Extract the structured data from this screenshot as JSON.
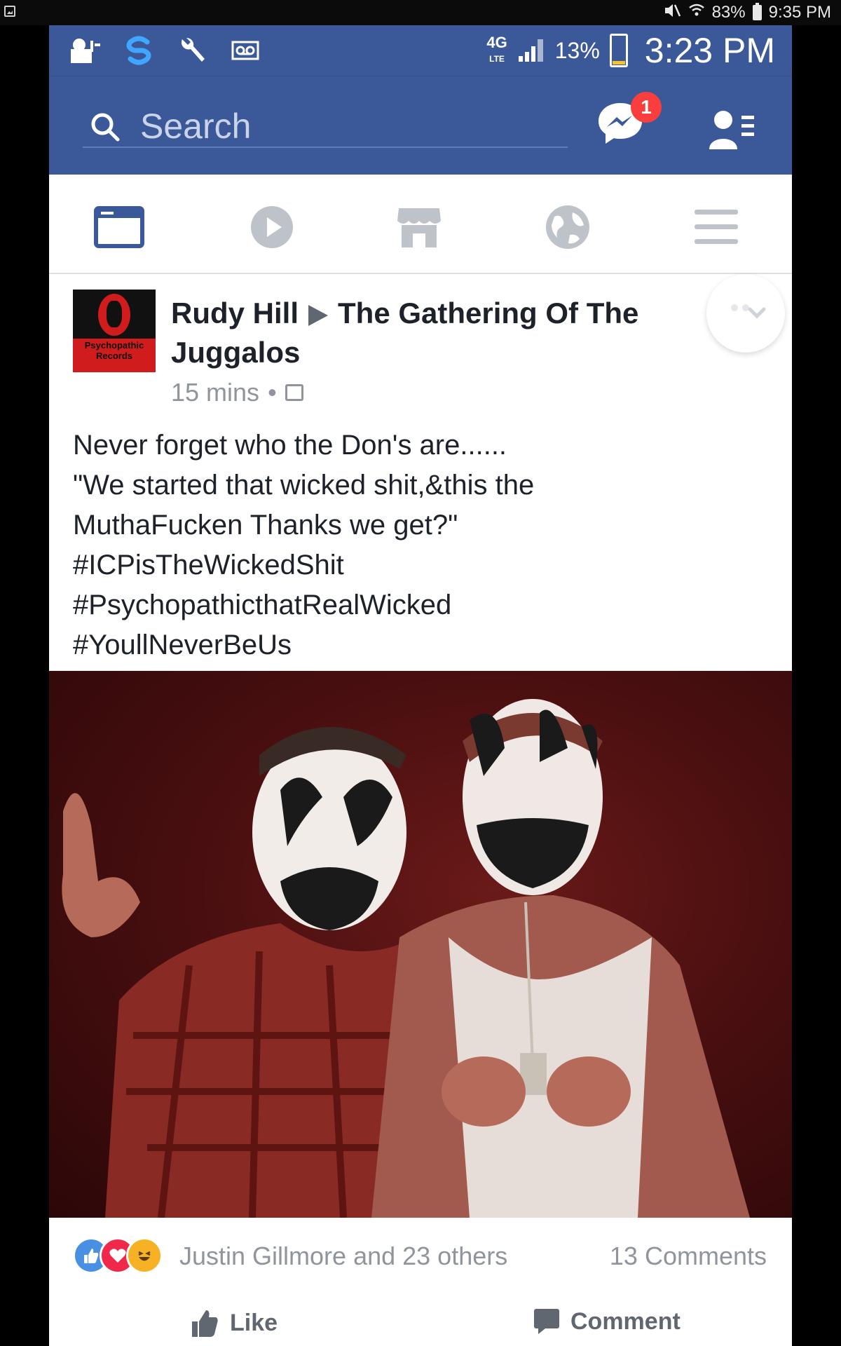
{
  "device_status": {
    "battery": "83%",
    "time": "9:35 PM"
  },
  "phone_status": {
    "network": "4G",
    "network_sub": "LTE",
    "battery": "13%",
    "time": "3:23 PM"
  },
  "header": {
    "search_placeholder": "Search",
    "messenger_badge": "1",
    "brand_color": "#3b5998"
  },
  "tabs": [
    {
      "name": "news-feed",
      "active": true
    },
    {
      "name": "video",
      "active": false
    },
    {
      "name": "marketplace",
      "active": false
    },
    {
      "name": "notifications",
      "active": false
    },
    {
      "name": "menu",
      "active": false
    }
  ],
  "post": {
    "avatar_text_1": "Psychopathic",
    "avatar_text_2": "Records",
    "author": "Rudy Hill",
    "target_line_1": "The Gathering Of The",
    "target_line_2": "Juggalos",
    "time": "15 mins",
    "text_lines": [
      "Never forget who the Don's are......",
      "\"We started that wicked shit,&this the",
      "MuthaFucken Thanks we get?\"",
      "#ICPisTheWickedShit",
      "#PsychopathicthatRealWicked",
      "#YoullNeverBeUs"
    ],
    "reactions_text": "Justin Gillmore and 23 others",
    "comments_text": "13 Comments",
    "like_label": "Like",
    "comment_label": "Comment"
  }
}
